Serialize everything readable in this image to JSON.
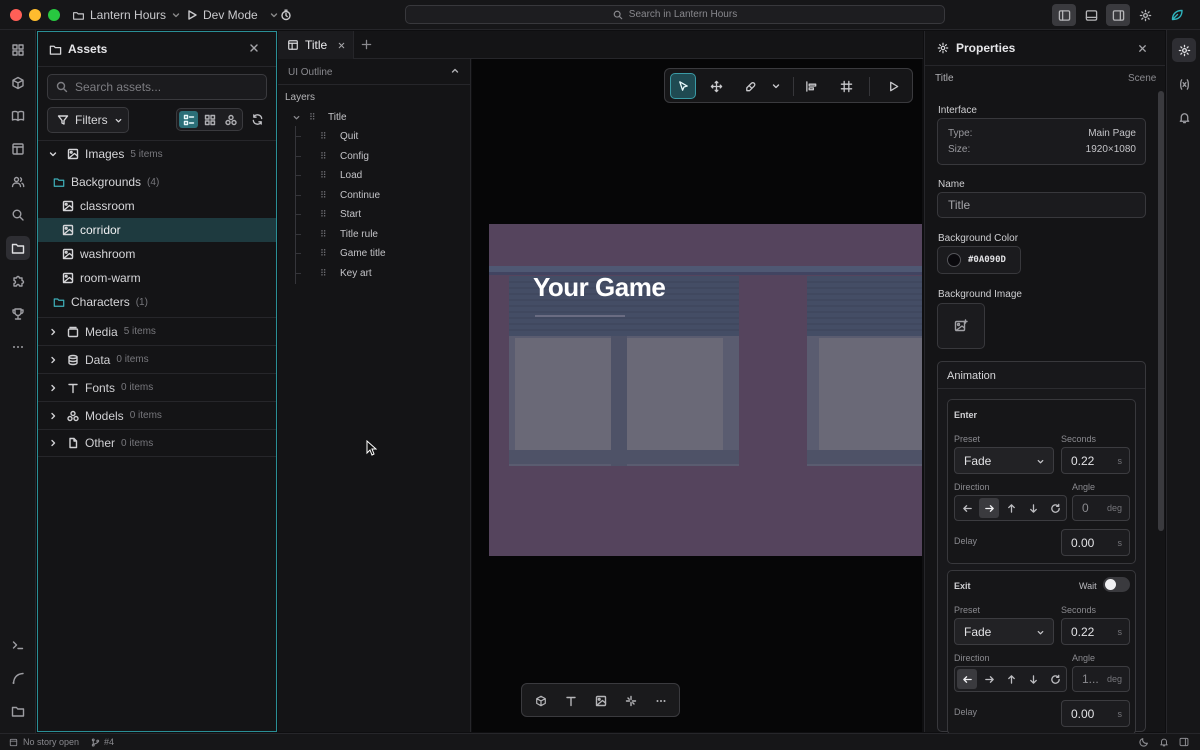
{
  "app": {
    "project_name": "Lantern Hours",
    "mode_label": "Dev Mode",
    "search_placeholder": "Search in Lantern Hours"
  },
  "window_controls": {
    "close_color": "#ff5f57",
    "minimize_color": "#febc2e",
    "maximize_color": "#28c840"
  },
  "accent_color": "#2a8f96",
  "assets": {
    "title": "Assets",
    "search_placeholder": "Search assets...",
    "filters_label": "Filters",
    "images": {
      "label": "Images",
      "count": "5 items"
    },
    "backgrounds": {
      "label": "Backgrounds",
      "count": "(4)"
    },
    "background_items": [
      "classroom",
      "corridor",
      "washroom",
      "room-warm"
    ],
    "selected_item": "corridor",
    "characters": {
      "label": "Characters",
      "count": "(1)"
    },
    "sections": [
      {
        "label": "Media",
        "count": "5 items",
        "icon": "media-icon"
      },
      {
        "label": "Data",
        "count": "0 items",
        "icon": "database-icon"
      },
      {
        "label": "Fonts",
        "count": "0 items",
        "icon": "font-icon"
      },
      {
        "label": "Models",
        "count": "0 items",
        "icon": "models-icon"
      },
      {
        "label": "Other",
        "count": "0 items",
        "icon": "file-icon"
      }
    ]
  },
  "tabs": [
    {
      "label": "Title"
    }
  ],
  "outline": {
    "header": "UI Outline",
    "layers_label": "Layers",
    "root": "Title",
    "children": [
      "Quit",
      "Config",
      "Load",
      "Continue",
      "Start",
      "Title rule",
      "Game title",
      "Key art"
    ]
  },
  "canvas": {
    "game_title": "Your Game",
    "tools": [
      "select-tool-icon",
      "move-tool-icon",
      "pan-tool-icon",
      "chevron-down-icon",
      "align-icon",
      "grid-icon",
      "play-icon"
    ],
    "bottom_tools": [
      "cube-icon",
      "text-icon",
      "image-icon",
      "sparkle-icon",
      "more-icon"
    ]
  },
  "properties": {
    "title": "Properties",
    "breadcrumb_left": "Title",
    "breadcrumb_right": "Scene",
    "interface_label": "Interface",
    "type_label": "Type:",
    "type_value": "Main Page",
    "size_label": "Size:",
    "size_value": "1920×1080",
    "name_label": "Name",
    "name_value": "Title",
    "bg_color_label": "Background Color",
    "bg_color_value": "#0A090D",
    "bg_image_label": "Background Image",
    "animation_label": "Animation",
    "enter": {
      "label": "Enter",
      "preset_label": "Preset",
      "preset_value": "Fade",
      "seconds_label": "Seconds",
      "seconds_value": "0.22",
      "seconds_unit": "s",
      "direction_label": "Direction",
      "angle_label": "Angle",
      "angle_value": "0",
      "angle_unit": "deg",
      "delay_label": "Delay",
      "delay_value": "0.00",
      "delay_unit": "s"
    },
    "exit": {
      "label": "Exit",
      "wait_label": "Wait",
      "preset_label": "Preset",
      "preset_value": "Fade",
      "seconds_label": "Seconds",
      "seconds_value": "0.22",
      "seconds_unit": "s",
      "direction_label": "Direction",
      "angle_label": "Angle",
      "angle_value": "1...",
      "angle_unit": "deg",
      "delay_label": "Delay",
      "delay_value": "0.00",
      "delay_unit": "s"
    }
  },
  "status": {
    "story": "No story open",
    "branch": "#4"
  }
}
